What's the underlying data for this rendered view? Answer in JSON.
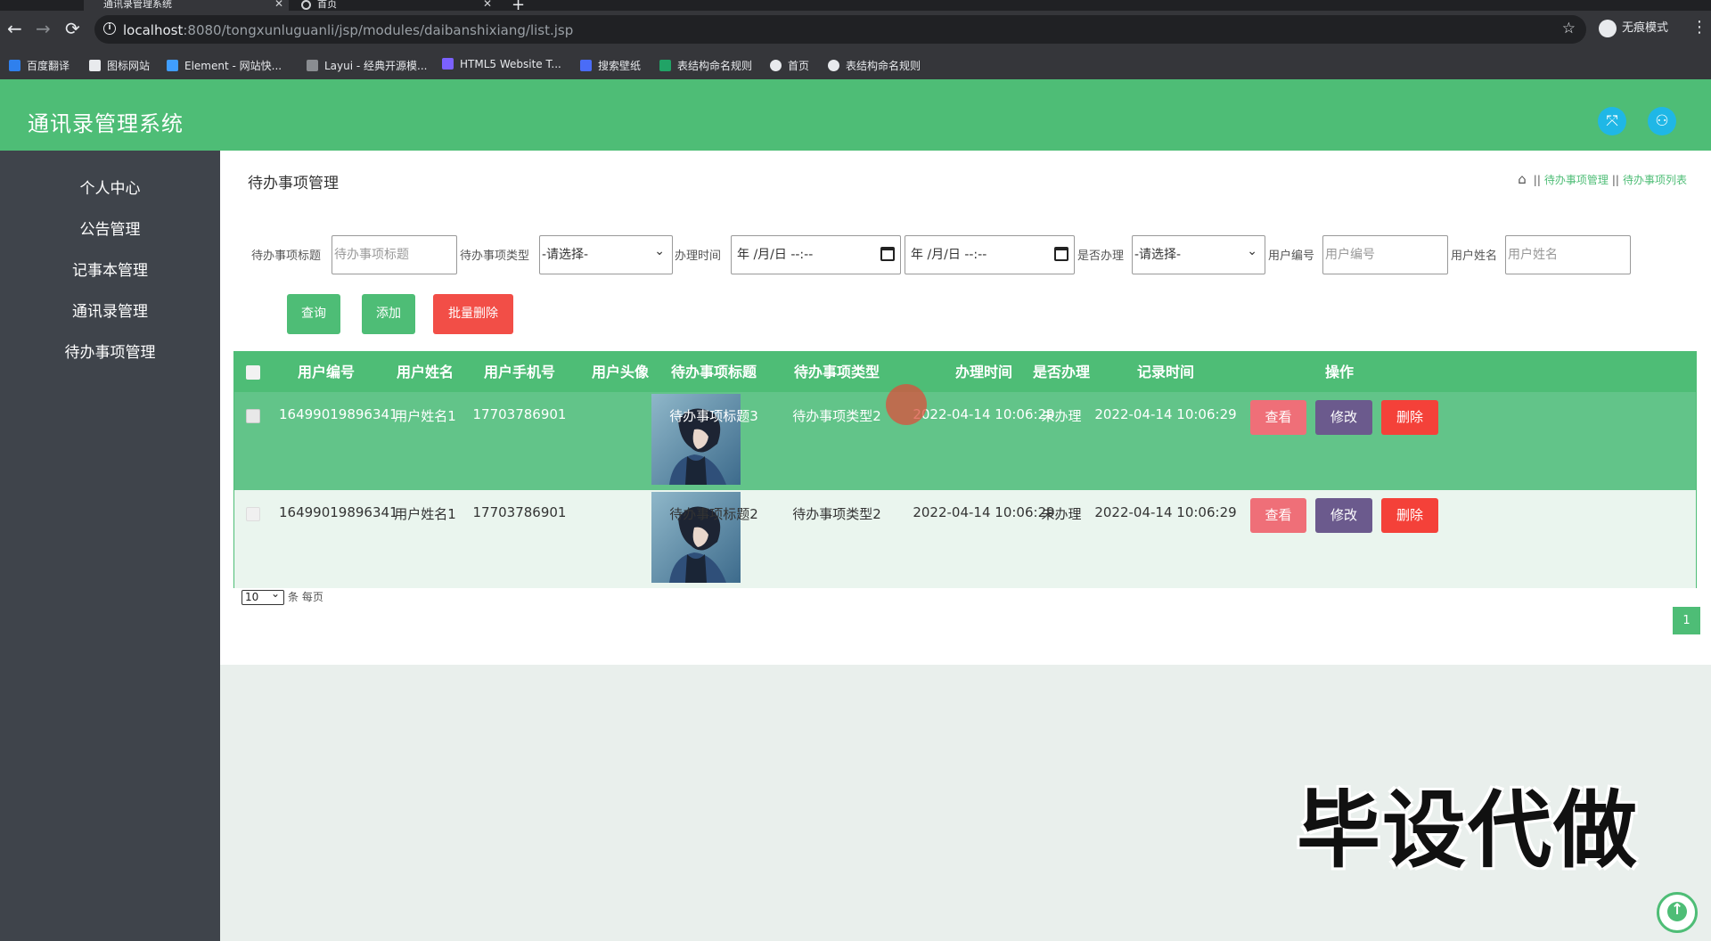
{
  "browser": {
    "tabs": [
      {
        "label": "通讯录管理系统",
        "active": true
      },
      {
        "label": "首页",
        "active": false
      }
    ],
    "url_host": "localhost",
    "url_rest": ":8080/tongxunluguanli/jsp/modules/daibanshixiang/list.jsp",
    "incognito_label": "无痕模式",
    "bookmarks": [
      "百度翻译",
      "图标网站",
      "Element - 网站快...",
      "Layui - 经典开源模...",
      "HTML5 Website T...",
      "搜索壁纸",
      "表结构命名规则",
      "首页",
      "表结构命名规则"
    ]
  },
  "header": {
    "title": "通讯录管理系统"
  },
  "sidebar": {
    "items": [
      "个人中心",
      "公告管理",
      "记事本管理",
      "通讯录管理",
      "待办事项管理"
    ]
  },
  "page": {
    "title": "待办事项管理",
    "breadcrumb": [
      "待办事项管理",
      "待办事项列表"
    ]
  },
  "filters": {
    "title_label": "待办事项标题",
    "title_placeholder": "待办事项标题",
    "type_label": "待办事项类型",
    "type_value": "-请选择-",
    "time_label": "办理时间",
    "date_placeholder_from": "年 /月/日 --:--",
    "date_placeholder_to": "年 /月/日 --:--",
    "done_label": "是否办理",
    "done_value": "-请选择-",
    "user_no_label": "用户编号",
    "user_no_placeholder": "用户编号",
    "user_name_label": "用户姓名",
    "user_name_placeholder": "用户姓名"
  },
  "actions": {
    "query": "查询",
    "add": "添加",
    "batch_delete": "批量删除"
  },
  "table": {
    "headers": [
      "用户编号",
      "用户姓名",
      "用户手机号",
      "用户头像",
      "待办事项标题",
      "待办事项类型",
      "办理时间",
      "是否办理",
      "记录时间",
      "操作"
    ],
    "rows": [
      {
        "user_no": "16499019896341",
        "user_name": "用户姓名1",
        "phone": "17703786901",
        "title": "待办事项标题3",
        "type": "待办事项类型2",
        "time": "2022-04-14 10:06:29",
        "done": "未办理",
        "record_time": "2022-04-14 10:06:29"
      },
      {
        "user_no": "16499019896341",
        "user_name": "用户姓名1",
        "phone": "17703786901",
        "title": "待办事项标题2",
        "type": "待办事项类型2",
        "time": "2022-04-14 10:06:29",
        "done": "未办理",
        "record_time": "2022-04-14 10:06:29"
      }
    ],
    "row_actions": {
      "view": "查看",
      "edit": "修改",
      "delete": "删除"
    }
  },
  "pagination": {
    "page_size": "10",
    "page_size_suffix": "条 每页",
    "current_page": "1"
  },
  "watermark": "毕设代做",
  "colors": {
    "primary": "#4ebd76",
    "sidebar": "#3f444b",
    "danger": "#f24e47",
    "edit": "#6b5a8d",
    "view": "#ef6f78"
  }
}
